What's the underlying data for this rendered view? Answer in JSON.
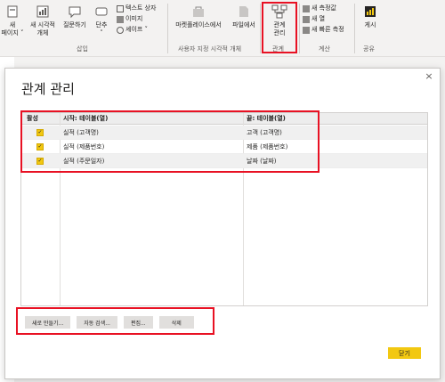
{
  "ribbon": {
    "new_page": "새\n페이지 ˅",
    "new_visual": "새 시각적\n개체",
    "ask_question": "질문하기",
    "buttons": "단추\n˅",
    "text_box": "텍스트 상자",
    "image": "이미지",
    "shapes": "셰이프 ˅",
    "insert_group": "삽입",
    "marketplace": "마켓플레이스에서",
    "from_file": "파일에서",
    "custom_visuals_group": "사용자 지정 시각적 개체",
    "manage_relationships": "관계\n관리",
    "relationships_group": "관계",
    "new_measure": "새 측정값",
    "new_column": "새 열",
    "new_quick_measure": "새 빠른 측정",
    "calc_group": "계산",
    "publish": "게시",
    "share_group": "공유"
  },
  "dialog": {
    "title": "관계 관리",
    "close_symbol": "×",
    "columns": {
      "active": "활성",
      "from": "시작: 테이블(열)",
      "to": "끝: 테이블(열)"
    },
    "rows": [
      {
        "active": true,
        "from": "실적 (고객명)",
        "to": "고객 (고객명)"
      },
      {
        "active": true,
        "from": "실적 (제품번호)",
        "to": "제품 (제품번호)"
      },
      {
        "active": true,
        "from": "실적 (주문일자)",
        "to": "날짜 (날짜)"
      }
    ],
    "check_mark": "✓",
    "buttons": {
      "new": "새로 만들기...",
      "autodetect": "자동 검색...",
      "edit": "편집...",
      "delete": "삭제"
    },
    "close_button": "닫기"
  },
  "colors": {
    "highlight": "#e81123",
    "accent_yellow": "#f2c811"
  },
  "icons": [
    "new-page-icon",
    "new-visual-icon",
    "qa-icon",
    "buttons-icon",
    "textbox-icon",
    "image-icon",
    "shapes-icon",
    "marketplace-icon",
    "file-icon",
    "relationships-icon",
    "measure-icon",
    "publish-icon",
    "close-icon",
    "checkbox-icon"
  ]
}
